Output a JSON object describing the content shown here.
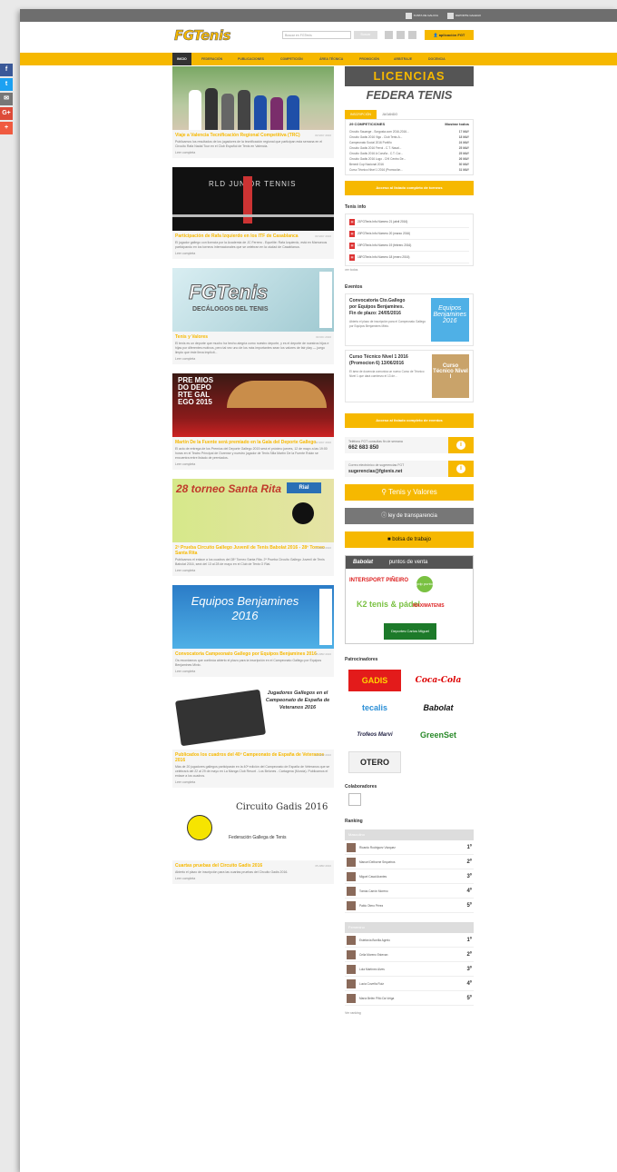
{
  "topbar": {
    "logo1": "XUNTA DE GALICIA",
    "logo2": "DEPORTE GALEGO"
  },
  "header": {
    "brand": "FGTenis",
    "search_placeholder": "Buscar en FGTenis",
    "search_button": "Buscar",
    "app_button": "aplicación FGT"
  },
  "nav": [
    "INICIO",
    "FEDERACIÓN",
    "PUBLICACIONES",
    "COMPETICIÓN",
    "ÁREA TÉCNICA",
    "PROMOCIÓN",
    "ARBITRAJE",
    "DOCENCIA"
  ],
  "articles": [
    {
      "title": "Viaje a Valencia Tecnificación Regional Competitiva (TRC)",
      "date": "03 MAY 2016",
      "text": "Publicamos los resultados de los jugadores de la tecnificación regional que participan esta semana en el Circuito Rafa Nadal Tour en el Club Español de Tenis en Valencia.",
      "more": "Leer completa"
    },
    {
      "title": "Participación de Rafa Izquierdo en los ITF de Casablanca",
      "date": "03 MAY 2016",
      "text": "El jugador gallego con licencia por la Academia de JC Ferrero - Equelite: Rafa Izquierdo, está en Marruecos participando en los torneos internacionales que se celebran en la ciudad de Casablanca.",
      "more": "Leer completa",
      "img_text": "RLD JUNIOR TENNIS"
    },
    {
      "title": "Tenis y Valores",
      "date": "03 DIC 2016",
      "text": "El tenis es un deporte que mucho ha hecho alegría como nuestro deporte, y es el deporte de nuestros hijos e hijas por diferentes motivos, pero tal vez uno de los más importantes sean los valores de fair play — juego limpio que éste lleva implícit...",
      "more": "Leer completa",
      "img_title": "FGTenis",
      "img_sub": "DECÁLOGOS DEL TENIS"
    },
    {
      "title": "Martín De la Fuente será premiado en la Gala del Deporte Gallego",
      "date": "11 MAY 2016",
      "text": "El acto de entrega de los Premios del Deporte Gallego 2015 será el próximo jueves, 12 de mayo a las 19:00 horas en el Teatro Principal de Ourense y nuestro jugador de Tenis Silla Martín De la Fuente Rolán se encuentra entre listado de premiados.",
      "more": "Leer completa",
      "img_text": "PRE MIOS DO DEPO RTE GAL EGO 2015"
    },
    {
      "title": "2ª Prueba Circuito Gallego Juvenil de Tenis Babolat 2016 - 28º Torneo Santa Rita",
      "date": "25 ABR 2016",
      "text": "Publicamos el enlace a los cuadros del 28º Torneo Santa Rita. 2ª Prueba Circuito Gallego Juvenil de Tenis Babolat 2016, será del 13 al 28 de mayo en el Club de Tenis O Rial.",
      "more": "Leer completa",
      "img_title": "28 torneo Santa Rita",
      "img_badge": "Rial"
    },
    {
      "title": "Convocatoria Campeonato Gallego por Equipos Benjamines 2016",
      "date": "25 ABR 2016",
      "text": "Os recordamos que continúa abierto el plazo para la inscripción en el Campeonato Gallego por Equipos Benjamines Mixto.",
      "more": "Leer completa",
      "img_text": "Equipos Benjamines 2016"
    },
    {
      "title": "Publicados los cuadros del 40º Campeonato de España de Veteranos 2016",
      "date": "21 ABR 2016",
      "text": "Más de 20 jugadores gallegos participarán en la 40ª edición del Campeonato de España de Veteranos que se celebrará del 22 al 29 de mayo en La Manga Club Resort - Los Belones - Cartagena (Murcia). Publicamos el enlace a los cuadros.",
      "more": "Leer completa",
      "img_text": "Jugadores Gallegos en el Campeonato de España de Veteranos 2016"
    },
    {
      "title": "Cuartas pruebas del Circuito Gadis 2016",
      "date": "05 ABR 2016",
      "text": "Abierto el plazo de inscripción para las cuartas pruebas del Circuito Gadis 2016.",
      "more": "Leer completa",
      "img_text": "Circuito Gadis 2016",
      "img_sub": "Federación Gallega de Tenis"
    }
  ],
  "side": {
    "licencias": "LICENCIAS",
    "federa": "FEDERA TENIS",
    "tabs": [
      "INSCRIPCIÓN",
      "JUGANDO"
    ],
    "comp_header": "29 COMPETICIONES",
    "comp_all": "Mostrar todos",
    "competitions": [
      [
        "Circuito Sauange - Sorgosta.com 2016-2016...",
        "17 MAY"
      ],
      [
        "Circuito Gadis 2016 Vigo - Club Tenis A...",
        "18 MAY"
      ],
      [
        "Campeonato Social 2016 Portiño",
        "24 MAY"
      ],
      [
        "Circuito Gadis 2016 Ferrol - C.T. Naval...",
        "25 MAY"
      ],
      [
        "Circuito Gadis 2016 A Coruña - C.T. Cor...",
        "25 MAY"
      ],
      [
        "Circuito Gadis 2016 Lugo - CHI Centro De...",
        "26 MAY"
      ],
      [
        "Benedi Cup Nacional 2016",
        "30 MAY"
      ],
      [
        "Curso Técnico Nivel 1 2016 (Promoción...",
        "31 MAY"
      ]
    ],
    "btn_torneos": "Acceso al listado completo de torneos",
    "tenis_info_title": "Tenis info",
    "tenis_info": [
      "21FGTenis Info Número 21 (abril 2016)",
      "20FGTenis Info Número 20 (marzo 2016)",
      "19FGTenis Info Número 19 (febrero 2016)",
      "18FGTenis Info Número 18 (enero 2016)"
    ],
    "ver_todos": "ver todos",
    "eventos_title": "Eventos",
    "eventos": [
      {
        "title": "Convocatoria Cto.Gallego por Equipos Benjamines. Fin de plazo: 24/05/2016",
        "text": "Abierto el plazo de inscripción para el Campeonato Gallego por Equipos Benjamines Mixto.",
        "pic": "Equipos Benjamines 2016"
      },
      {
        "title": "Curso Técnico Nivel 1 2016 (Promocion 6) 13/06/2016",
        "text": "El área de docencia comunica un nuevo Curso de Técnico Nivel 1 que dará comienzo el 13 de...",
        "pic": "Curso Técnico Nivel I"
      }
    ],
    "btn_eventos": "Acceso al listado completo de eventos",
    "phone_label": "Teléfono FGT consultas fin de semana",
    "phone": "662 683 850",
    "mail_label": "Correo electrónico de sugerencias FGT",
    "mail": "sugerencias@fgtenis.net",
    "banner_valores": "Tenis y Valores",
    "banner_transp": "ley de transparencia",
    "banner_trabajo": "bolsa de trabajo",
    "babolat": "Babolat",
    "puntos": "puntos de venta",
    "partners": [
      "INTERSPORT PIÑEIRO",
      "pdp punto de partido",
      "K2 tenis & pádel",
      "MAXIMATENIS",
      "Deportes Carlos Miguel"
    ],
    "patrocinadores_title": "Patrocinadores",
    "sponsors": [
      "GADIS",
      "Coca-Cola",
      "tecalis",
      "Babolat",
      "Trofeos Marvi",
      "GreenSet",
      "OTERO"
    ],
    "colaboradores_title": "Colaboradores",
    "ranking_title": "Ranking",
    "ranking_m_label": "Masculino",
    "ranking_m": [
      [
        "Ricardo Rodríguez Vázquez",
        "1º"
      ],
      [
        "Manuel Delborne Sequeiros",
        "2º"
      ],
      [
        "Miguel Casal Arantes",
        "3º"
      ],
      [
        "Tomás Carrón Moreno",
        "4º"
      ],
      [
        "Pablo Otero Pérez",
        "5º"
      ]
    ],
    "ranking_f_label": "Femenino",
    "ranking_f": [
      [
        "Estefanía Bonilla Agreio",
        "1º"
      ],
      [
        "Celia Moreno Estevan",
        "2º"
      ],
      [
        "Lola Martínez Alves",
        "3º"
      ],
      [
        "Lucía Coveña Ruiz",
        "4º"
      ],
      [
        "María Belén Piñó Da Veiga",
        "5º"
      ]
    ],
    "ver_ranking": "Ver ranking"
  },
  "share": [
    "f",
    "t",
    "✉",
    "G+",
    "+"
  ],
  "colors": {
    "accent": "#f6b800",
    "dark": "#333333"
  }
}
